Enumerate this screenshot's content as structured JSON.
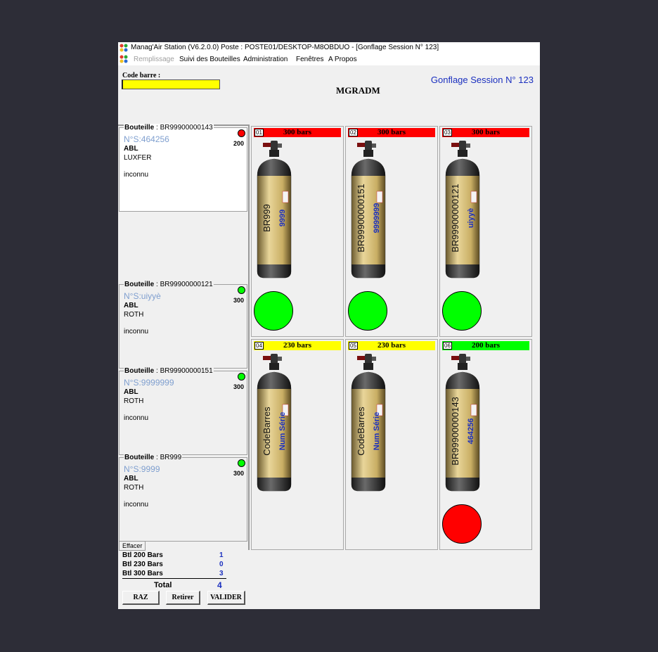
{
  "window": {
    "title": "Manag'Air Station (V6.2.0.0)  Poste : POSTE01/DESKTOP-M8OBDUO - [Gonflage Session N° 123]"
  },
  "menu": {
    "items": [
      "Remplissage",
      "Suivi des Bouteilles",
      "Administration",
      "Fenêtres",
      "A Propos"
    ]
  },
  "form": {
    "code_barre_label": "Code barre :",
    "code_barre_value": "",
    "user": "MGRADM",
    "session": "Gonflage Session N° 123"
  },
  "colors": {
    "red": "#ff0000",
    "yellow": "#ffff00",
    "green": "#00ff00",
    "blue_text": "#1a2fbf"
  },
  "bottles": [
    {
      "label": "Bouteille",
      "code": ": BR99900000143",
      "ns": "N°S:464256",
      "brand": "ABL",
      "model": "LUXFER",
      "status": "inconnu",
      "pressure": "200",
      "dot": "#ff0000"
    },
    {
      "label": "Bouteille",
      "code": ": BR99900000121",
      "ns": "N°S:uiyyè",
      "brand": "ABL",
      "model": "ROTH",
      "status": "inconnu",
      "pressure": "300",
      "dot": "#00ff00"
    },
    {
      "label": "Bouteille",
      "code": ": BR99900000151",
      "ns": "N°S:9999999",
      "brand": "ABL",
      "model": "ROTH",
      "status": "inconnu",
      "pressure": "300",
      "dot": "#00ff00"
    },
    {
      "label": "Bouteille",
      "code": ": BR999",
      "ns": "N°S:9999",
      "brand": "ABL",
      "model": "ROTH",
      "status": "inconnu",
      "pressure": "300",
      "dot": "#00ff00"
    }
  ],
  "effacer_label": "Effacer",
  "stations": [
    {
      "num": "01",
      "pressure": "300 bars",
      "hdr_color": "#ff0000",
      "barcode": "BR999",
      "serial": "9999",
      "status_color": "#00ff00"
    },
    {
      "num": "02",
      "pressure": "300 bars",
      "hdr_color": "#ff0000",
      "barcode": "BR99900000151",
      "serial": "9999999",
      "status_color": "#00ff00"
    },
    {
      "num": "03",
      "pressure": "300 bars",
      "hdr_color": "#ff0000",
      "barcode": "BR99900000121",
      "serial": "uiyyè",
      "status_color": "#00ff00"
    },
    {
      "num": "04",
      "pressure": "230 bars",
      "hdr_color": "#ffff00",
      "barcode": "CodeBarres",
      "serial": "Num Série",
      "status_color": ""
    },
    {
      "num": "05",
      "pressure": "230 bars",
      "hdr_color": "#ffff00",
      "barcode": "CodeBarres",
      "serial": "Num Série",
      "status_color": ""
    },
    {
      "num": "06",
      "pressure": "200 bars",
      "hdr_color": "#00ff00",
      "barcode": "BR99900000143",
      "serial": "464256",
      "status_color": "#ff0000"
    }
  ],
  "totals": {
    "rows": [
      {
        "label": "Btl 200 Bars",
        "value": "1"
      },
      {
        "label": "Btl 230 Bars",
        "value": "0"
      },
      {
        "label": "Btl 300 Bars",
        "value": "3"
      }
    ],
    "total_label": "Total",
    "total_value": "4"
  },
  "buttons": {
    "raz": "RAZ",
    "retirer": "Retirer",
    "valider": "VALIDER"
  }
}
